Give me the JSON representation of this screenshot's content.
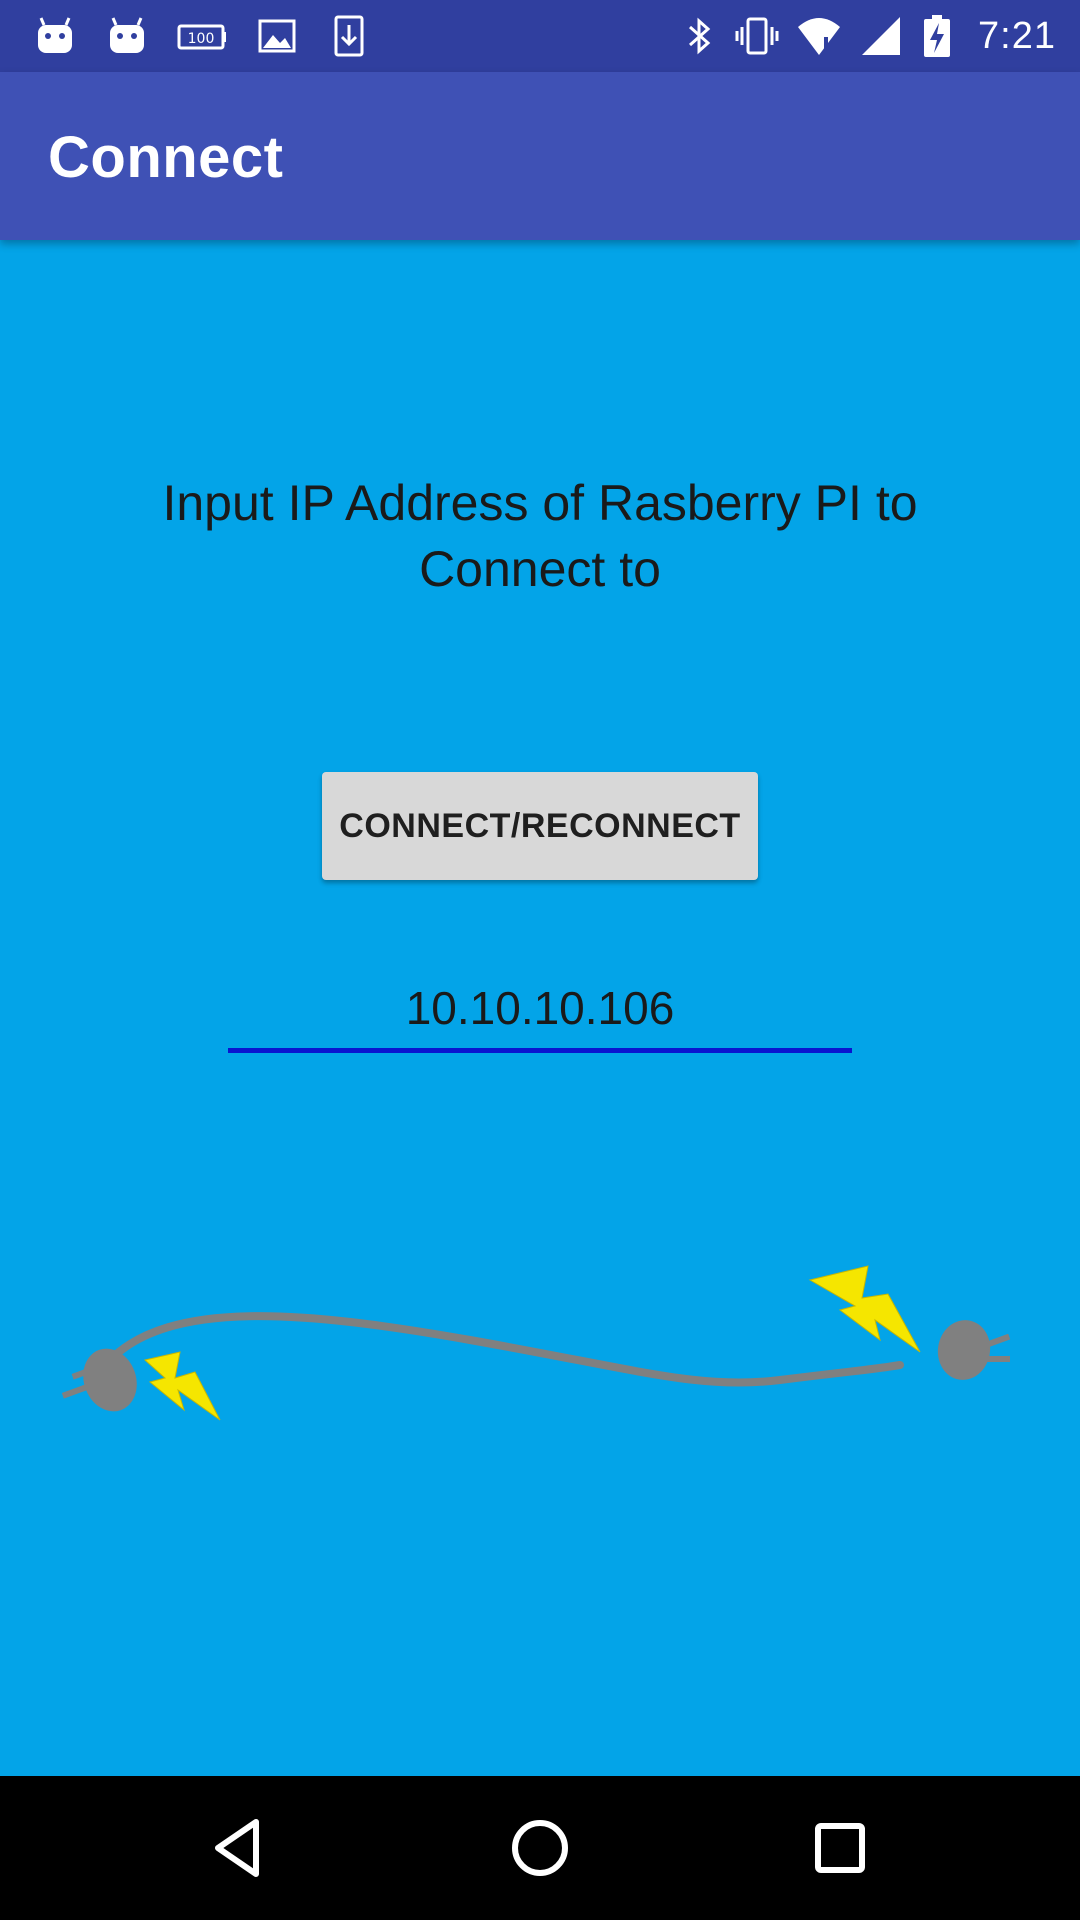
{
  "status_bar": {
    "left_icons": [
      "android-icon",
      "android-icon",
      "battery-100-icon",
      "image-icon",
      "download-icon"
    ],
    "right_icons": [
      "bluetooth-icon",
      "vibrate-icon",
      "wifi-icon",
      "signal-icon",
      "battery-charging-icon"
    ],
    "time": "7:21"
  },
  "app_bar": {
    "title": "Connect"
  },
  "main": {
    "instruction": "Input IP Address of Rasberry PI to Connect to",
    "connect_button_label": "CONNECT/RECONNECT",
    "ip_address_value": "10.10.10.106",
    "illustration": "unplugged-cable-icon"
  },
  "nav_bar": {
    "buttons": [
      "back-icon",
      "home-icon",
      "recents-icon"
    ]
  },
  "colors": {
    "status_bar": "#303f9f",
    "app_bar": "#3f51b5",
    "background": "#03a4e8",
    "button": "#d8d8d8",
    "input_underline": "#0a14d0",
    "cable": "#808080",
    "spark": "#f5e600"
  }
}
